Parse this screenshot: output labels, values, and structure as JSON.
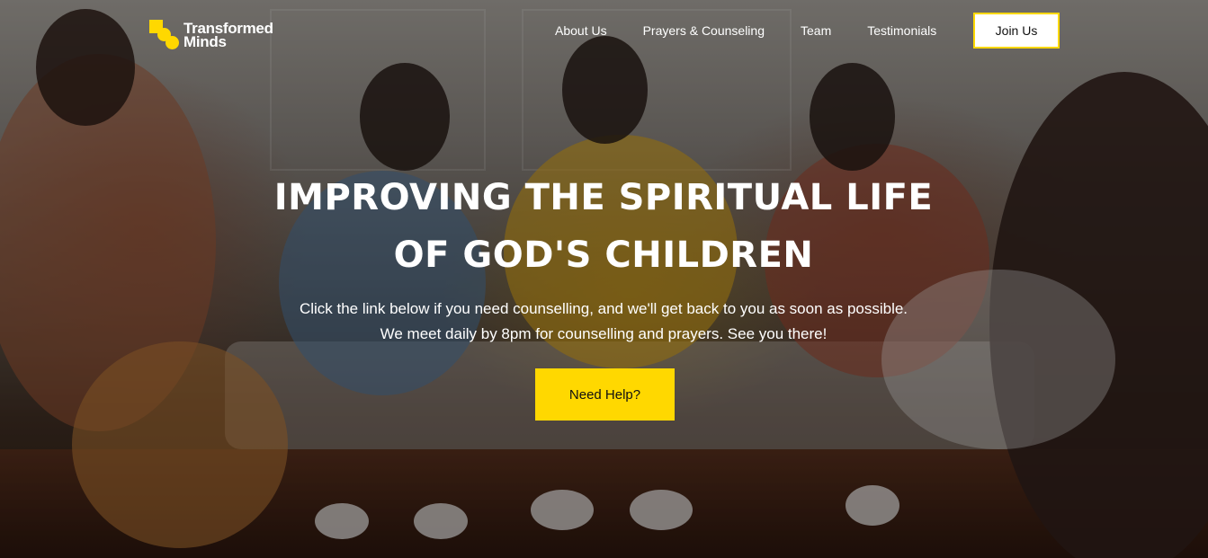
{
  "brand": {
    "name_line1": "Transformed",
    "name_line2": "Minds",
    "accent_color": "#ffd800"
  },
  "nav": {
    "items": [
      {
        "label": "About Us"
      },
      {
        "label": "Prayers & Counseling"
      },
      {
        "label": "Team"
      },
      {
        "label": "Testimonials"
      }
    ],
    "cta_label": "Join Us"
  },
  "hero": {
    "headline_line1": "IMPROVING THE SPIRITUAL LIFE",
    "headline_line2": "OF GOD'S CHILDREN",
    "subtext": "Click the link below if you need counselling, and we'll get back to you as soon as possible. We meet daily by 8pm for counselling and prayers. See you there!",
    "button_label": "Need Help?"
  }
}
